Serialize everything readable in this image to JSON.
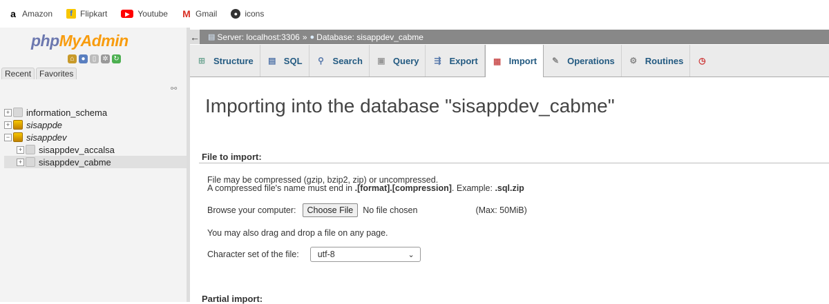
{
  "bookmarks": [
    {
      "label": "Amazon",
      "icon": "amazon-icon"
    },
    {
      "label": "Flipkart",
      "icon": "flipkart-icon"
    },
    {
      "label": "Youtube",
      "icon": "youtube-icon"
    },
    {
      "label": "Gmail",
      "icon": "gmail-icon"
    },
    {
      "label": "icons",
      "icon": "github-icon"
    }
  ],
  "logo": {
    "part1": "php",
    "part2": "MyAdmin"
  },
  "nav": {
    "recent_tab": "Recent",
    "favorites_tab": "Favorites",
    "tree": [
      {
        "label": "information_schema"
      },
      {
        "label": "sisappde"
      },
      {
        "label": "sisappdev"
      },
      {
        "label": "sisappdev_accalsa"
      },
      {
        "label": "sisappdev_cabme"
      }
    ]
  },
  "breadcrumb": {
    "server": "Server: localhost:3306",
    "separator": "»",
    "database": "Database: sisappdev_cabme"
  },
  "tabs": [
    {
      "label": "Structure",
      "icon": "structure-icon"
    },
    {
      "label": "SQL",
      "icon": "sql-icon"
    },
    {
      "label": "Search",
      "icon": "search-icon"
    },
    {
      "label": "Query",
      "icon": "query-icon"
    },
    {
      "label": "Export",
      "icon": "export-icon"
    },
    {
      "label": "Import",
      "icon": "import-icon",
      "active": true
    },
    {
      "label": "Operations",
      "icon": "wrench-icon"
    },
    {
      "label": "Routines",
      "icon": "routines-icon"
    }
  ],
  "page": {
    "title": "Importing into the database \"sisappdev_cabme\"",
    "file_section": "File to import:",
    "note1": "File may be compressed (gzip, bzip2, zip) or uncompressed.",
    "note2_prefix": "A compressed file's name must end in ",
    "note2_format": ".[format].[compression]",
    "note2_mid": ". Example: ",
    "note2_example": ".sql.zip",
    "browse_label": "Browse your computer:",
    "choose_button": "Choose File",
    "no_file": "No file chosen",
    "max_size": "(Max: 50MiB)",
    "drag_note": "You may also drag and drop a file on any page.",
    "charset_label": "Character set of the file:",
    "charset_value": "utf-8",
    "partial_section": "Partial import:"
  },
  "colors": {
    "accent": "#235a81",
    "logo_blue": "#6c78af",
    "logo_orange": "#f89c0e"
  }
}
